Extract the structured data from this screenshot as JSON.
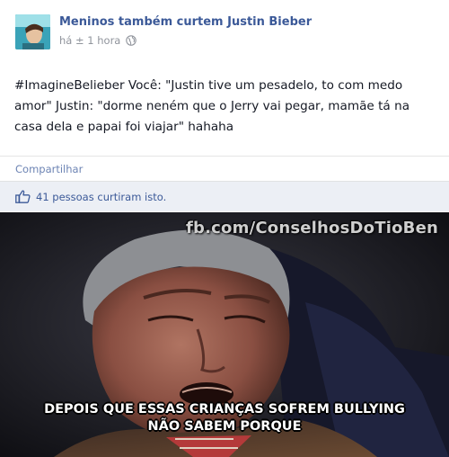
{
  "post": {
    "page_name": "Meninos também curtem Justin Bieber",
    "timestamp": "há ± 1 hora",
    "text": "#ImagineBelieber Você: \"Justin tive um pesadelo, to com medo amor\" Justin: \"dorme neném que o Jerry vai pegar, mamãe tá na casa dela e papai foi viajar\" hahaha",
    "share_label": "Compartilhar",
    "likes_text": "41 pessoas curtiram isto.",
    "avatar_icon": "profile-photo",
    "globe_icon": "globe-icon",
    "like_icon": "thumbs-up-icon"
  },
  "meme": {
    "watermark": "fb.com/ConselhosDoTioBen",
    "caption_line1": "DEPOIS QUE ESSAS CRIANÇAS SOFREM BULLYING",
    "caption_line2": "NÃO SABEM PORQUE"
  },
  "colors": {
    "link_blue": "#3b5998",
    "muted_gray": "#90949c",
    "likes_bg": "#eceff5"
  }
}
